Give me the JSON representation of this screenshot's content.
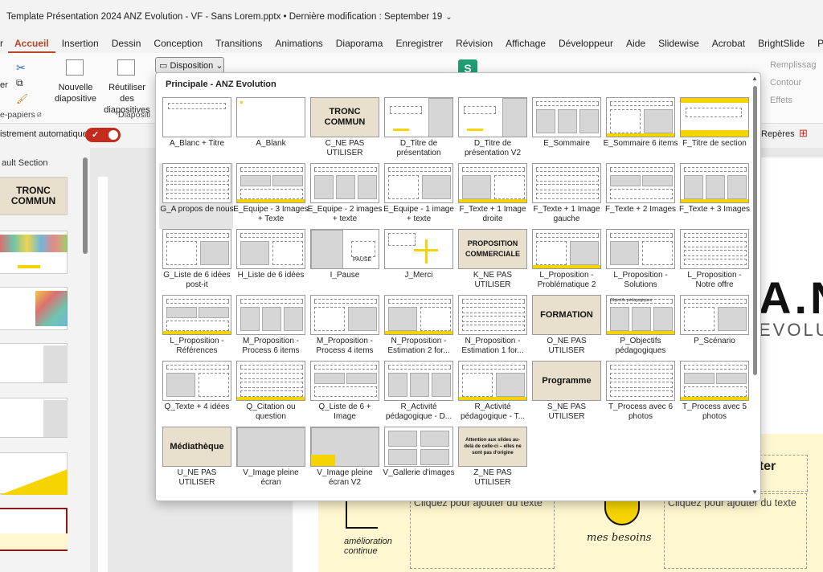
{
  "window": {
    "title": "Template Présentation 2024 ANZ Evolution - VF - Sans Lorem.pptx • Dernière modification : September 19"
  },
  "tabs": [
    "r",
    "Accueil",
    "Insertion",
    "Dessin",
    "Conception",
    "Transitions",
    "Animations",
    "Diaporama",
    "Enregistrer",
    "Révision",
    "Affichage",
    "Développeur",
    "Aide",
    "Slidewise",
    "Acrobat",
    "BrightSlide",
    "PPTools"
  ],
  "ribbon": {
    "new_slide": "Nouvelle diapositive",
    "reuse_slides": "Réutiliser des diapositives",
    "disposition": "Disposition",
    "clipboard_group": "e-papiers",
    "slides_group": "Diapositi",
    "cut_label": "er",
    "remplissage": "Remplissag",
    "contour": "Contour",
    "effets": "Effets",
    "reperes": "Repères"
  },
  "autosave": {
    "label": "istrement automatique"
  },
  "left_pane": {
    "section": "ault Section",
    "first_thumb": "TRONC COMMUN"
  },
  "gallery": {
    "header": "Principale - ANZ Evolution",
    "layouts": [
      "A_Blanc + Titre",
      "A_Blank",
      "C_NE PAS UTILISER",
      "D_Titre de présentation",
      "D_Titre de présentation V2",
      "E_Sommaire",
      "E_Sommaire 6 items",
      "F_Titre de section",
      "G_A propos de nous",
      "E_Equipe - 3 Images + Texte",
      "E_Equipe - 2 images + texte",
      "E_Equipe - 1 image + texte",
      "F_Texte + 1 Image droite",
      "F_Texte + 1 Image gauche",
      "F_Texte + 2 Images",
      "F_Texte + 3 Images",
      "G_Liste de 6 idées post-it",
      "H_Liste de 6 idées",
      "I_Pause",
      "J_Merci",
      "K_NE PAS UTILISER",
      "L_Proposition - Problématique 2",
      "L_Proposition - Solutions",
      "L_Proposition - Notre offre",
      "L_Proposition - Références",
      "M_Proposition - Process 6 items",
      "M_Proposition - Process 4 items",
      "N_Proposition - Estimation 2 for...",
      "N_Proposition - Estimation 1 for...",
      "O_NE PAS UTILISER",
      "P_Objectifs pédagogiques",
      "P_Scénario",
      "Q_Texte + 4 idées",
      "Q_Citation ou question",
      "Q_Liste de 6 + Image",
      "R_Activité pédagogique - D...",
      "R_Activité pédagogique - T...",
      "S_NE PAS UTILISER",
      "T_Process avec 6 photos",
      "T_Process avec 5 photos",
      "U_NE PAS UTILISER",
      "V_Image pleine écran",
      "V_Image pleine écran V2",
      "V_Gallerie d'images",
      "Z_NE PAS UTILISER"
    ],
    "thumb_texts": {
      "tronc": "TRONC COMMUN",
      "proposition": "PROPOSITION COMMERCIALE",
      "formation": "FORMATION",
      "programme": "Programme",
      "mediatheque": "Médiathèque",
      "pause": "PAUSE",
      "attention": "Attention aux slides au-delà de celle-ci – elles ne sont pas d'origine",
      "objectifs": "Objectifs pédagogiques"
    }
  },
  "slide": {
    "brand_big": "A.N",
    "brand_sub": "EVOLU",
    "ajouter": "uter",
    "box_text": "Cliquez pour ajouter du texte",
    "box_text2": "Cliquez pour ajouter du texte",
    "besoins": "mes besoins",
    "amelioration": "amélioration continue"
  }
}
